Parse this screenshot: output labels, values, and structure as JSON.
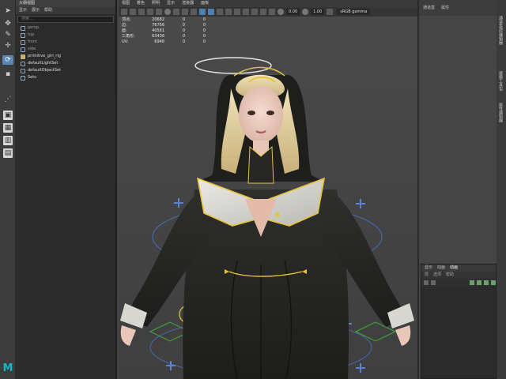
{
  "outliner": {
    "title": "大纲视图",
    "menu": [
      "显示",
      "展示",
      "帮助"
    ],
    "search_placeholder": "搜索...",
    "items": [
      {
        "label": "persp",
        "bright": false,
        "icon": "camera"
      },
      {
        "label": "top",
        "bright": false,
        "icon": "camera"
      },
      {
        "label": "front",
        "bright": false,
        "icon": "camera"
      },
      {
        "label": "side",
        "bright": false,
        "icon": "camera"
      },
      {
        "label": "primitive_girl_rig",
        "bright": true,
        "icon": "group"
      },
      {
        "label": "defaultLightSet",
        "bright": true,
        "icon": "set"
      },
      {
        "label": "defaultObjectSet",
        "bright": true,
        "icon": "set"
      },
      {
        "label": "Sets",
        "bright": true,
        "icon": "set"
      }
    ]
  },
  "viewport": {
    "menu": [
      "视图",
      "着色",
      "照明",
      "显示",
      "渲染器",
      "面板"
    ],
    "near_clip": "0.00",
    "scale": "1.00",
    "camera_name": "sRGB gamma",
    "hud": [
      {
        "label": "顶点:",
        "a": "20682",
        "b": "0",
        "c": "0"
      },
      {
        "label": "边:",
        "a": "76756",
        "b": "0",
        "c": "0"
      },
      {
        "label": "面:",
        "a": "40561",
        "b": "0",
        "c": "0"
      },
      {
        "label": "三角形:",
        "a": "63436",
        "b": "0",
        "c": "0"
      },
      {
        "label": "UV:",
        "a": "6948",
        "b": "0",
        "c": "0"
      }
    ]
  },
  "rightpanel": {
    "tabs": [
      "通道盒",
      "属性"
    ],
    "channel_tabs": [
      "显示",
      "动画",
      "动画"
    ],
    "channel_menu": [
      "层",
      "选项",
      "帮助"
    ]
  },
  "vstrip": [
    "通道盒/层编辑器",
    "建模工具包",
    "属性编辑器"
  ],
  "colors": {
    "accent": "#5a87b6",
    "maya_logo": "#15b5c9",
    "rig_gold": "#e6c33a",
    "rig_blue": "#4c6fc4",
    "rig_green": "#3fa83f"
  }
}
